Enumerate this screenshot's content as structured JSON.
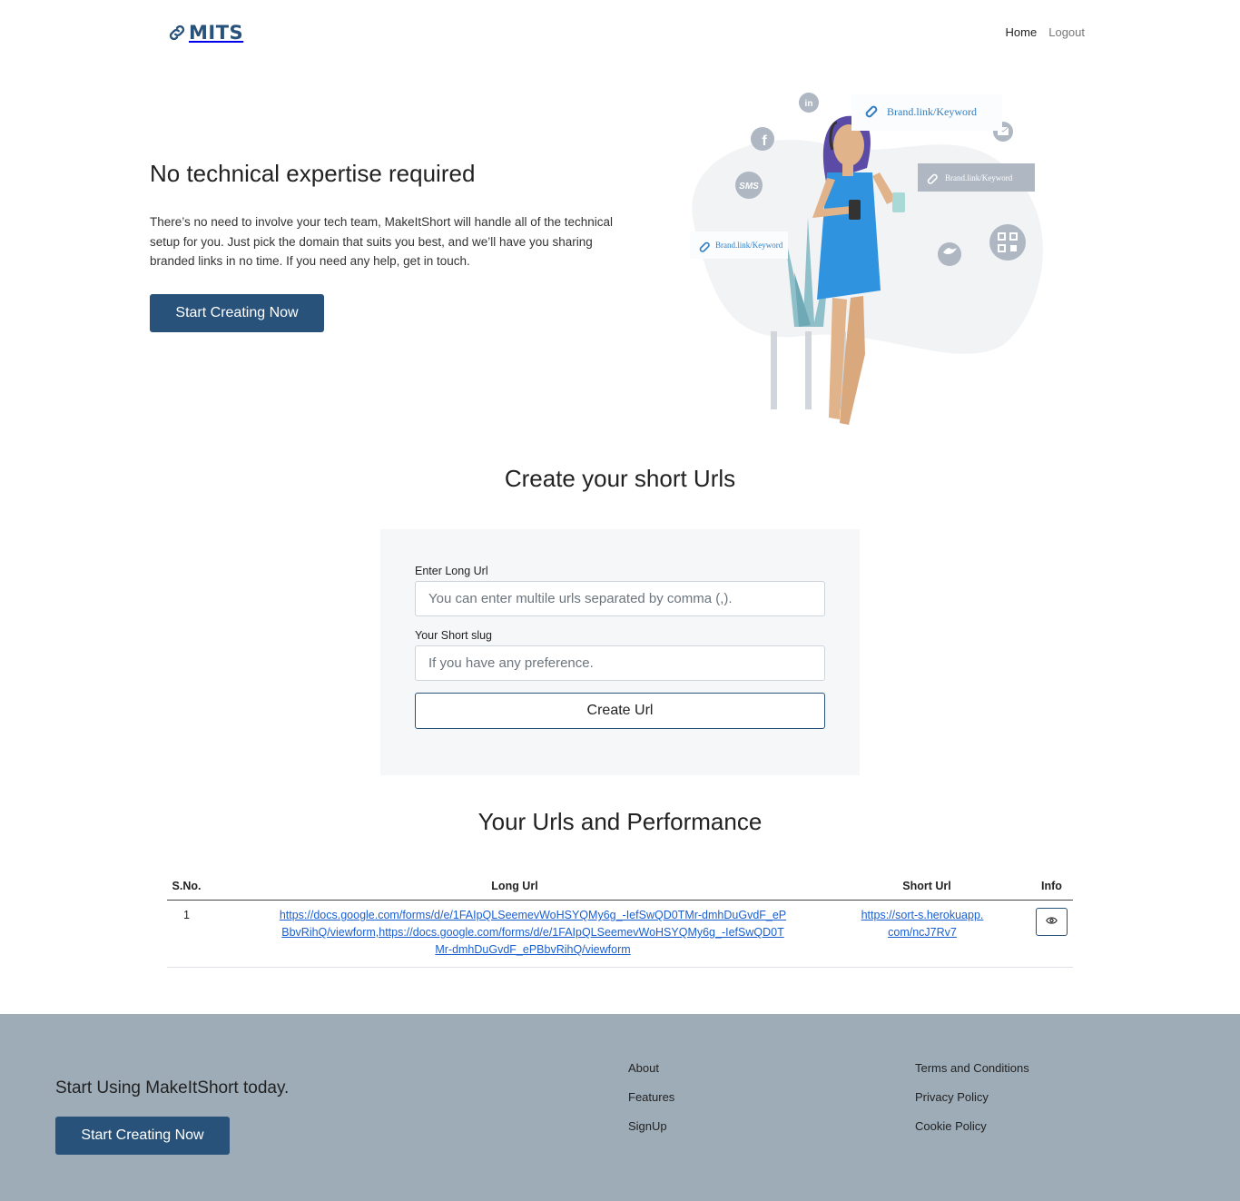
{
  "nav": {
    "logo_text": "MITS",
    "home": "Home",
    "logout": "Logout"
  },
  "hero": {
    "title": "No technical expertise required",
    "text": "There’s no need to involve your tech team, MakeItShort will handle all of the technical setup for you. Just pick the domain that suits you best, and we’ll have you sharing branded links in no time. If you need any help, get in touch.",
    "button": "Start Creating Now",
    "illustration": {
      "badge_1": "Brand.link/Keyword",
      "badge_2": "Brand.link/Keyword",
      "badge_3": "Brand.link/Keyword",
      "sms": "SMS",
      "linkedin": "in"
    }
  },
  "create": {
    "title": "Create your short Urls",
    "long_url_label": "Enter Long Url",
    "long_url_placeholder": "You can enter multile urls separated by comma (,).",
    "long_url_value": "",
    "slug_label": "Your Short slug",
    "slug_placeholder": "If you have any preference.",
    "slug_value": "",
    "button": "Create Url"
  },
  "performance": {
    "title": "Your Urls and Performance",
    "columns": [
      "S.No.",
      "Long Url",
      "Short Url",
      "Info"
    ],
    "rows": [
      {
        "sno": "1",
        "long_url": "https://docs.google.com/forms/d/e/1FAIpQLSeemevWoHSYQMy6g_-IefSwQD0TMr-dmhDuGvdF_ePBbvRihQ/viewform,https://docs.google.com/forms/d/e/1FAIpQLSeemevWoHSYQMy6g_-IefSwQD0TMr-dmhDuGvdF_ePBbvRihQ/viewform",
        "short_url": "https://sort-s.herokuapp.com/ncJ7Rv7",
        "info_icon": "eye-icon"
      }
    ]
  },
  "footer": {
    "cta": "Start Using MakeItShort today.",
    "button": "Start Creating Now",
    "col1": [
      "About",
      "Features",
      "SignUp"
    ],
    "col2": [
      "Terms and Conditions",
      "Privacy Policy",
      "Cookie Policy"
    ]
  },
  "colors": {
    "brand": "#28527a",
    "footer_bg": "#9eacb8",
    "form_bg": "#f5f7f9",
    "link": "#1a5fd0"
  }
}
